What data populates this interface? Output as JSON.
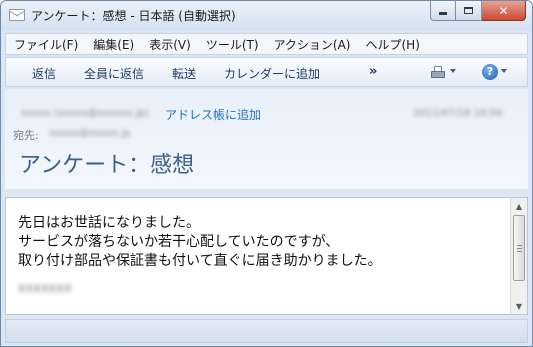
{
  "window": {
    "title": "アンケート：感想 - 日本語 (自動選択)"
  },
  "menu": {
    "items": [
      {
        "label": "ファイル(F)"
      },
      {
        "label": "編集(E)"
      },
      {
        "label": "表示(V)"
      },
      {
        "label": "ツール(T)"
      },
      {
        "label": "アクション(A)"
      },
      {
        "label": "ヘルプ(H)"
      }
    ]
  },
  "toolbar": {
    "reply": "返信",
    "reply_all": "全員に返信",
    "forward": "転送",
    "add_to_calendar": "カレンダーに追加",
    "more": "»",
    "print_icon": "printer-icon",
    "help_icon": "help-icon"
  },
  "header": {
    "sender_blurred": "xxxxx (xxxxx@xxxxxx.jp)",
    "add_to_contacts": "アドレス帳に追加",
    "date_blurred": "2011/07/18 10:50",
    "to_label": "宛先:",
    "to_blurred": "xxxxx@xxxxx.jp",
    "subject": "アンケート：感想"
  },
  "message": {
    "lines": [
      "先日はお世話になりました。",
      "サービスが落ちないか若干心配していたのですが、",
      "取り付け部品や保証書も付いて直ぐに届き助かりました。"
    ],
    "signature_blurred": "xxxxxxx"
  },
  "colors": {
    "accent_blue": "#1e6fc2",
    "subject_color": "#3a5f8a",
    "close_button": "#c94a33"
  }
}
